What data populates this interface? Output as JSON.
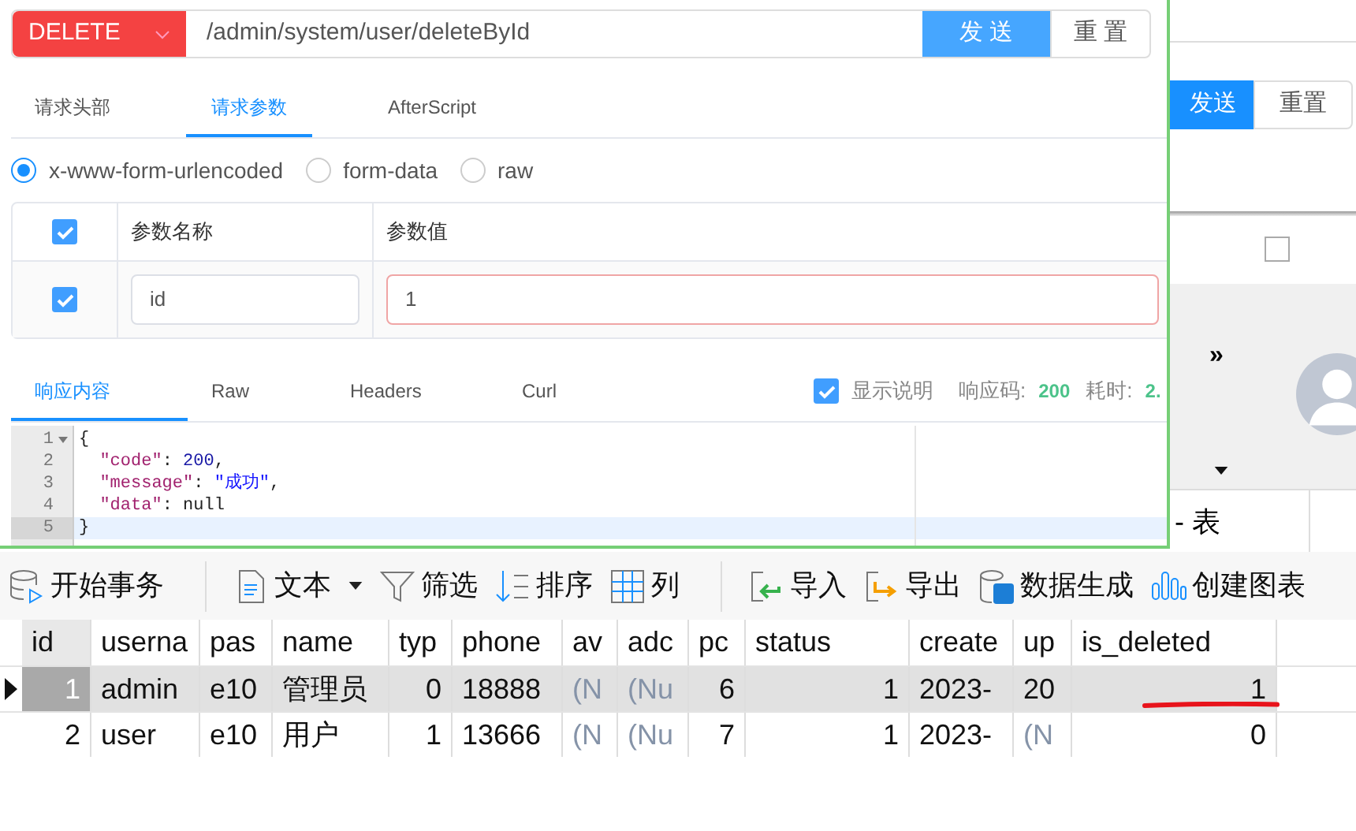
{
  "background_window": {
    "buttons": [
      {
        "label": "发送",
        "kind": "primary"
      },
      {
        "label": "重置",
        "kind": "plain"
      }
    ],
    "checkbox": {
      "checked": false
    },
    "expand_glyph": "»",
    "title_fragment": "- 表"
  },
  "request": {
    "method": "DELETE",
    "url": "/admin/system/user/deleteById",
    "buttons": [
      {
        "label": "发 送",
        "kind": "primary"
      },
      {
        "label": "重 置",
        "kind": "plain"
      }
    ]
  },
  "tabs": [
    {
      "label": "请求头部",
      "selected": false
    },
    {
      "label": "请求参数",
      "selected": true
    },
    {
      "label": "AfterScript",
      "selected": false
    }
  ],
  "body_types": [
    {
      "label": "x-www-form-urlencoded",
      "selected": true
    },
    {
      "label": "form-data",
      "selected": false
    },
    {
      "label": "raw",
      "selected": false
    }
  ],
  "params": {
    "all_checked": true,
    "columns": [
      "参数名称",
      "参数值"
    ],
    "rows": [
      {
        "checked": true,
        "name": "id",
        "value": "1",
        "invalid": true
      }
    ]
  },
  "response": {
    "tabs": [
      {
        "label": "响应内容",
        "selected": true
      },
      {
        "label": "Raw",
        "selected": false
      },
      {
        "label": "Headers",
        "selected": false
      },
      {
        "label": "Curl",
        "selected": false
      }
    ],
    "show_description": {
      "label": "显示说明",
      "checked": true
    },
    "status_label": "响应码:",
    "status": "200",
    "time_label": "耗时:",
    "time": "2.",
    "code_lines": [
      {
        "number": "1",
        "foldable": true,
        "active": false,
        "tokens": [
          {
            "kind": "punct",
            "text": "{"
          }
        ]
      },
      {
        "number": "2",
        "foldable": false,
        "active": false,
        "tokens": [
          {
            "kind": "key",
            "text": "  \"code\""
          },
          {
            "kind": "punct",
            "text": ": "
          },
          {
            "kind": "number",
            "text": "200"
          },
          {
            "kind": "punct",
            "text": ","
          }
        ]
      },
      {
        "number": "3",
        "foldable": false,
        "active": false,
        "tokens": [
          {
            "kind": "key",
            "text": "  \"message\""
          },
          {
            "kind": "punct",
            "text": ": "
          },
          {
            "kind": "string",
            "text": "\"成功\""
          },
          {
            "kind": "punct",
            "text": ","
          }
        ]
      },
      {
        "number": "4",
        "foldable": false,
        "active": false,
        "tokens": [
          {
            "kind": "key",
            "text": "  \"data\""
          },
          {
            "kind": "punct",
            "text": ": "
          },
          {
            "kind": "punct",
            "text": "null"
          }
        ]
      },
      {
        "number": "5",
        "foldable": false,
        "active": true,
        "tokens": [
          {
            "kind": "punct",
            "text": "}"
          }
        ]
      }
    ]
  },
  "toolbar": [
    {
      "label": "开始事务",
      "kind": "database"
    },
    {
      "label": "文本",
      "kind": "document",
      "dropdown": true
    },
    {
      "label": "筛选",
      "kind": "filter"
    },
    {
      "label": "排序",
      "kind": "sort"
    },
    {
      "label": "列",
      "kind": "columns"
    },
    {
      "label": "导入",
      "kind": "import"
    },
    {
      "label": "导出",
      "kind": "export"
    },
    {
      "label": "数据生成",
      "kind": "generate"
    },
    {
      "label": "创建图表",
      "kind": "chart"
    }
  ],
  "table": {
    "columns": [
      {
        "label": "id",
        "numeric": true
      },
      {
        "label": "userna",
        "numeric": false
      },
      {
        "label": "pas",
        "numeric": false
      },
      {
        "label": "name",
        "numeric": false
      },
      {
        "label": "typ",
        "numeric": true
      },
      {
        "label": "phone",
        "numeric": false
      },
      {
        "label": "av",
        "numeric": false
      },
      {
        "label": "adc",
        "numeric": false
      },
      {
        "label": "pc",
        "numeric": true
      },
      {
        "label": "status",
        "numeric": true
      },
      {
        "label": "create",
        "numeric": false
      },
      {
        "label": "up",
        "numeric": false
      },
      {
        "label": "is_deleted",
        "numeric": true
      }
    ],
    "rows": [
      {
        "selected": true,
        "cells": [
          {
            "text": "1"
          },
          {
            "text": "admin"
          },
          {
            "text": "e10"
          },
          {
            "text": "管理员"
          },
          {
            "text": "0"
          },
          {
            "text": "18888"
          },
          {
            "text": "(N",
            "null": true
          },
          {
            "text": "(Nu",
            "null": true
          },
          {
            "text": "6"
          },
          {
            "text": "1"
          },
          {
            "text": "2023-"
          },
          {
            "text": "20"
          },
          {
            "text": "1",
            "underlined": true
          }
        ]
      },
      {
        "selected": false,
        "cells": [
          {
            "text": "2"
          },
          {
            "text": "user"
          },
          {
            "text": "e10"
          },
          {
            "text": "用户"
          },
          {
            "text": "1"
          },
          {
            "text": "13666"
          },
          {
            "text": "(N",
            "null": true
          },
          {
            "text": "(Nu",
            "null": true
          },
          {
            "text": "7"
          },
          {
            "text": "1"
          },
          {
            "text": "2023-"
          },
          {
            "text": "(N",
            "null": true
          },
          {
            "text": "0"
          }
        ]
      }
    ]
  }
}
